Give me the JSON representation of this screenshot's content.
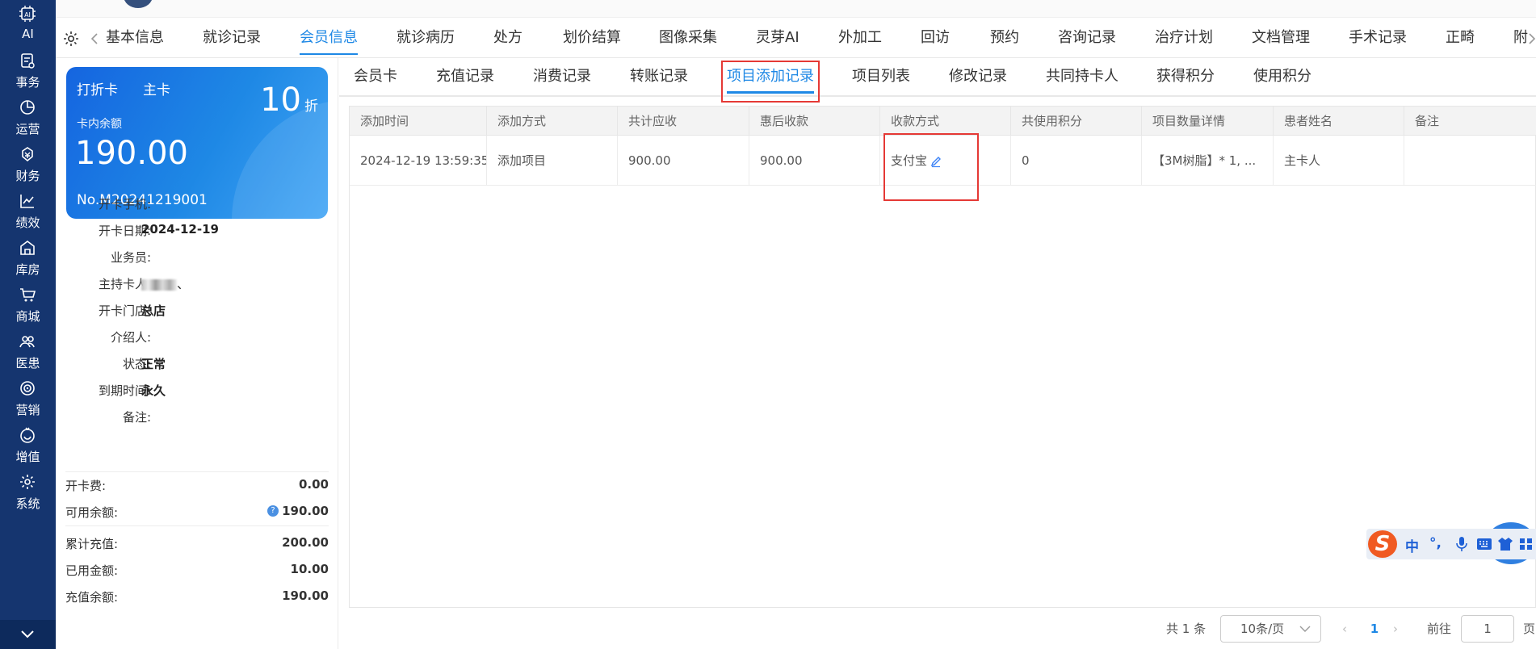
{
  "rail": {
    "items": [
      {
        "label": "AI",
        "icon": "ai-chip-icon"
      },
      {
        "label": "事务",
        "icon": "task-icon"
      },
      {
        "label": "运营",
        "icon": "pie-icon"
      },
      {
        "label": "财务",
        "icon": "money-icon"
      },
      {
        "label": "绩效",
        "icon": "trend-icon"
      },
      {
        "label": "库房",
        "icon": "warehouse-icon"
      },
      {
        "label": "商城",
        "icon": "cart-icon"
      },
      {
        "label": "医患",
        "icon": "people-icon"
      },
      {
        "label": "营销",
        "icon": "target-icon"
      },
      {
        "label": "增值",
        "icon": "smile-icon"
      },
      {
        "label": "系统",
        "icon": "gear-icon"
      }
    ]
  },
  "mainnav": {
    "tabs": [
      "基本信息",
      "就诊记录",
      "会员信息",
      "就诊病历",
      "处方",
      "划价结算",
      "图像采集",
      "灵芽AI",
      "外加工",
      "回访",
      "预约",
      "咨询记录",
      "治疗计划",
      "文档管理",
      "手术记录",
      "正畸",
      "附"
    ],
    "active": "会员信息"
  },
  "card": {
    "type1": "打折卡",
    "type2": "主卡",
    "discount": "10",
    "discount_unit": "折",
    "balance_label": "卡内余额",
    "balance": "190.00",
    "number": "No.M20241219001"
  },
  "info": [
    {
      "label": "开卡手机:",
      "value": ""
    },
    {
      "label": "开卡日期:",
      "value": "2024-12-19"
    },
    {
      "label": "业务员:",
      "value": ""
    },
    {
      "label": "主持卡人:",
      "value": "、"
    },
    {
      "label": "开卡门店:",
      "value": "总店"
    },
    {
      "label": "介绍人:",
      "value": ""
    },
    {
      "label": "状态:",
      "value": "正常"
    },
    {
      "label": "到期时间:",
      "value": "永久"
    },
    {
      "label": "备注:",
      "value": ""
    }
  ],
  "stats1": [
    {
      "label": "开卡费:",
      "value": "0.00"
    },
    {
      "label": "可用余额:",
      "value": "190.00"
    }
  ],
  "stats2": [
    {
      "label": "累计充值:",
      "value": "200.00"
    },
    {
      "label": "已用金额:",
      "value": "10.00"
    },
    {
      "label": "充值余额:",
      "value": "190.00"
    }
  ],
  "subnav": {
    "tabs": [
      "会员卡",
      "充值记录",
      "消费记录",
      "转账记录",
      "项目添加记录",
      "项目列表",
      "修改记录",
      "共同持卡人",
      "获得积分",
      "使用积分"
    ],
    "active": "项目添加记录"
  },
  "table": {
    "columns": [
      "添加时间",
      "添加方式",
      "共计应收",
      "惠后收款",
      "收款方式",
      "共使用积分",
      "项目数量详情",
      "患者姓名",
      "备注"
    ],
    "rows": [
      [
        "2024-12-19 13:59:35",
        "添加项目",
        "900.00",
        "900.00",
        "支付宝",
        "0",
        "【3M树脂】* 1, ...",
        "主卡人",
        ""
      ]
    ]
  },
  "pagination": {
    "total": "共 1 条",
    "page_size": "10条/页",
    "current": "1",
    "goto_label": "前往",
    "goto_value": "1",
    "page_suffix": "页"
  },
  "ime": {
    "cn": "中",
    "punct": "°,"
  },
  "colors": {
    "accent": "#1e88e5",
    "rail": "#15356f",
    "highlight": "#e53935"
  }
}
